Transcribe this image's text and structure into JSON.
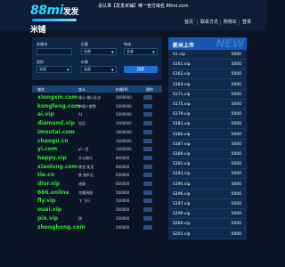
{
  "header": {
    "logo_main": "88mi",
    "logo_cn": "发发米铺",
    "notice": "请认准【发发米铺】唯一官方域名 88mi.com",
    "nav": [
      "首页",
      "联系方式",
      "购物车",
      "登录"
    ]
  },
  "filter": {
    "labels": [
      "关键词",
      "后缀",
      "构成",
      "类别",
      "价格"
    ],
    "values": [
      "",
      "全部",
      "全部",
      "全部",
      "全部"
    ],
    "search_label": "搜索"
  },
  "table": {
    "headers": [
      "域名",
      "含义",
      "价格(¥)",
      "操作"
    ],
    "rows": [
      {
        "domain": "xiongxin.com",
        "meaning": "雄心 雄心壮志",
        "price": "5000000"
      },
      {
        "domain": "kongfeng.com",
        "meaning": "中国人都院",
        "price": "5000000"
      },
      {
        "domain": "ai.vip",
        "meaning": "AI",
        "price": "5000000"
      },
      {
        "domain": "diamond.vip",
        "meaning": "钻石",
        "price": "3000000"
      },
      {
        "domain": "imoutai.com",
        "meaning": "",
        "price": "1800000"
      },
      {
        "domain": "chaogu.cn",
        "meaning": "",
        "price": "1600000"
      },
      {
        "domain": "yi.com",
        "meaning": "yi一百",
        "price": "1000000"
      },
      {
        "domain": "happy.vip",
        "meaning": "开心快乐",
        "price": "800000"
      },
      {
        "domain": "xiaolong.com",
        "meaning": "晓龙 笑龙",
        "price": "800000"
      },
      {
        "domain": "tie.cn",
        "meaning": "铁 铁矿石",
        "price": "600000"
      },
      {
        "domain": "dior.vip",
        "meaning": "迪奥",
        "price": "600000"
      },
      {
        "domain": "666.online",
        "meaning": "完美网络",
        "price": "500000"
      },
      {
        "domain": "fly.vip",
        "meaning": "飞 飞行",
        "price": "500000"
      },
      {
        "domain": "ouai.vip",
        "meaning": "",
        "price": "500000"
      },
      {
        "domain": "pin.vip",
        "meaning": "拼",
        "price": "500000"
      },
      {
        "domain": "zhonghong.com",
        "meaning": "",
        "price": "500000"
      }
    ]
  },
  "side": {
    "title": "新米上市",
    "badge": "NEW",
    "items": [
      {
        "name": "S1.vip",
        "price": "5000"
      },
      {
        "name": "S161.vip",
        "price": "5000"
      },
      {
        "name": "S162.vip",
        "price": "5000"
      },
      {
        "name": "S163.vip",
        "price": "5000"
      },
      {
        "name": "S171.vip",
        "price": "5000"
      },
      {
        "name": "S175.vip",
        "price": "5000"
      },
      {
        "name": "S179.vip",
        "price": "5000"
      },
      {
        "name": "S181.vip",
        "price": "5000"
      },
      {
        "name": "S186.vip",
        "price": "5000"
      },
      {
        "name": "S187.vip",
        "price": "5000"
      },
      {
        "name": "S189.vip",
        "price": "5000"
      },
      {
        "name": "S191.vip",
        "price": "5000"
      },
      {
        "name": "S193.vip",
        "price": "5000"
      },
      {
        "name": "S195.vip",
        "price": "5000"
      },
      {
        "name": "S196.vip",
        "price": "5000"
      },
      {
        "name": "S197.vip",
        "price": "5000"
      },
      {
        "name": "S199.vip",
        "price": "5000"
      },
      {
        "name": "S200.vip",
        "price": "5000"
      },
      {
        "name": "S201.vip",
        "price": "5000"
      }
    ]
  },
  "colors": {
    "background": "#0b1526",
    "domain_green": "#2ee12e",
    "accent_blue": "#1858b0"
  }
}
